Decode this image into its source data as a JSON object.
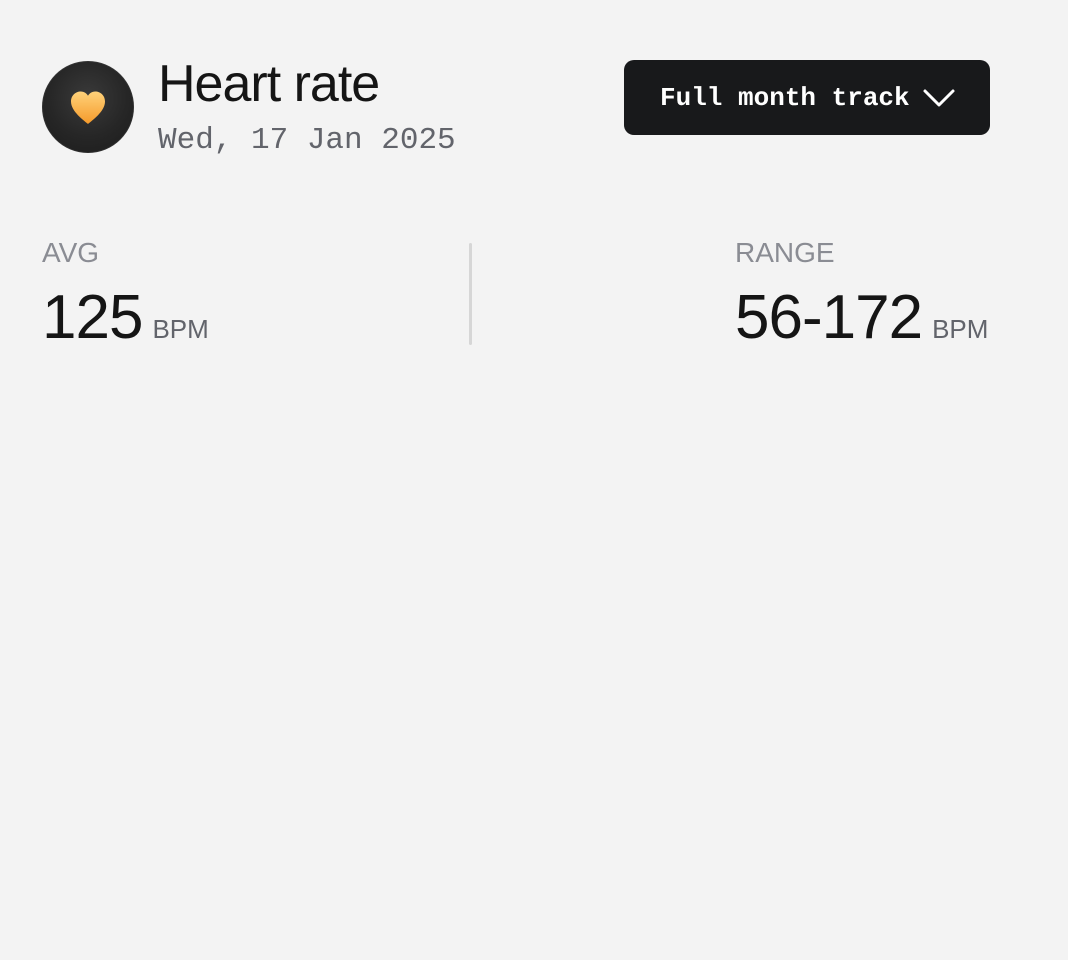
{
  "header": {
    "icon": "heart-icon",
    "title": "Heart rate",
    "date": "Wed, 17 Jan 2025",
    "range_select": {
      "selected": "Full month track",
      "icon": "chevron-down-icon"
    }
  },
  "stats": {
    "avg": {
      "label": "AVG",
      "value": "125",
      "unit": "BPM"
    },
    "range": {
      "label": "RANGE",
      "value": "56-172",
      "unit": "BPM"
    }
  },
  "colors": {
    "background": "#f3f3f3",
    "heart_gradient_top": "#ffd27a",
    "heart_gradient_bottom": "#f59a2a",
    "button_bg": "#18191b",
    "muted_text": "#8a8c93"
  }
}
